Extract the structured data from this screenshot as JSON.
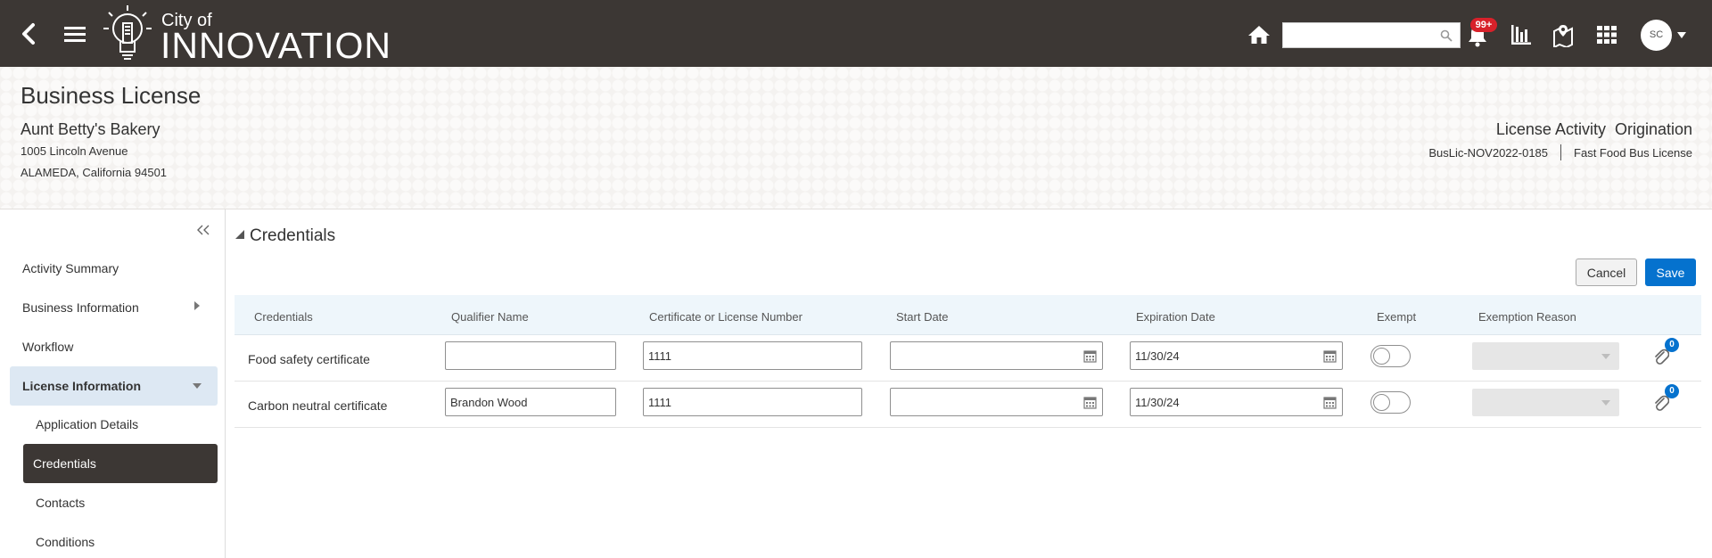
{
  "header": {
    "logo_small": "City of",
    "logo_big": "INNOVATION",
    "notification_count": "99+",
    "avatar_initials": "SC",
    "search_value": "",
    "icons": [
      "back-icon",
      "menu-icon",
      "lightbulb-logo-icon",
      "home-icon",
      "search-icon",
      "bell-icon",
      "bar-chart-icon",
      "map-pin-icon",
      "apps-grid-icon",
      "caret-down-icon"
    ]
  },
  "banner": {
    "title": "Business License",
    "business_name": "Aunt Betty's Bakery",
    "address_line1": "1005 Lincoln Avenue",
    "address_line2": "ALAMEDA, California 94501",
    "activity_label": "License Activity  Origination",
    "license_id": "BusLic-NOV2022-0185",
    "license_type": "Fast Food Bus License"
  },
  "nav": {
    "items": [
      {
        "label": "Activity Summary"
      },
      {
        "label": "Business Information"
      },
      {
        "label": "Workflow"
      },
      {
        "label": "License Information"
      }
    ],
    "sub_items": [
      {
        "label": "Application Details"
      },
      {
        "label": "Credentials"
      },
      {
        "label": "Contacts"
      },
      {
        "label": "Conditions"
      }
    ]
  },
  "main": {
    "section_title": "Credentials",
    "cancel_label": "Cancel",
    "save_label": "Save",
    "columns": [
      "Credentials",
      "Qualifier Name",
      "Certificate or License Number",
      "Start Date",
      "Expiration Date",
      "Exempt",
      "Exemption Reason"
    ],
    "rows": [
      {
        "credential": "Food safety certificate",
        "qualifier": "",
        "license_number": "1111",
        "start_date": "",
        "expiration_date": "11/30/24",
        "exempt": false,
        "attachments": "0"
      },
      {
        "credential": "Carbon neutral certificate",
        "qualifier": "Brandon Wood",
        "license_number": "1111",
        "start_date": "",
        "expiration_date": "11/30/24",
        "exempt": false,
        "attachments": "0"
      }
    ]
  },
  "colors": {
    "topbar": "#3c3734",
    "primary_button": "#0572ce",
    "nav_active_group": "#dde8f3",
    "nav_selected": "#3c3734",
    "table_header": "#eef6fb",
    "badge_red": "#d8212a"
  }
}
